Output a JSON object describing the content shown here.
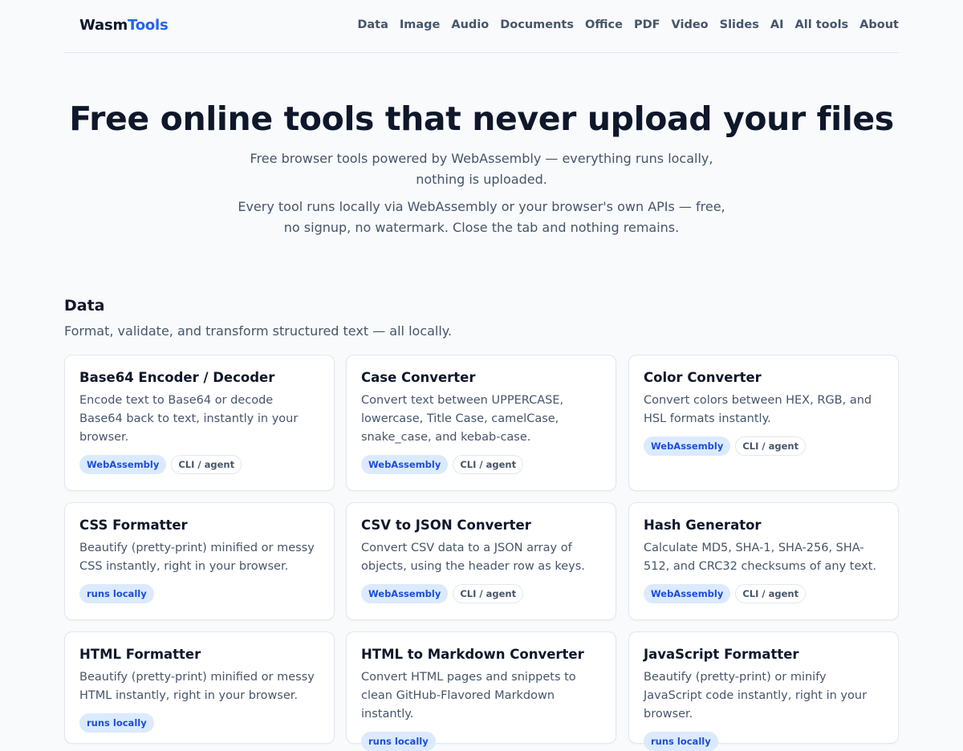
{
  "header": {
    "logo_part1": "Wasm",
    "logo_part2": "Tools",
    "nav": [
      "Data",
      "Image",
      "Audio",
      "Documents",
      "Office",
      "PDF",
      "Video",
      "Slides",
      "AI",
      "All tools",
      "About"
    ]
  },
  "hero": {
    "title": "Free online tools that never upload your files",
    "subtitle1": "Free browser tools powered by WebAssembly — everything runs locally, nothing is uploaded.",
    "subtitle2": "Every tool runs locally via WebAssembly or your browser's own APIs — free, no signup, no watermark. Close the tab and nothing remains."
  },
  "section": {
    "title": "Data",
    "description": "Format, validate, and transform structured text — all locally."
  },
  "cards": [
    {
      "title": "Base64 Encoder / Decoder",
      "desc": "Encode text to Base64 or decode Base64 back to text, instantly in your browser.",
      "badges": [
        "WebAssembly",
        "CLI / agent"
      ]
    },
    {
      "title": "Case Converter",
      "desc": "Convert text between UPPERCASE, lowercase, Title Case, camelCase, snake_case, and kebab-case.",
      "badges": [
        "WebAssembly",
        "CLI / agent"
      ]
    },
    {
      "title": "Color Converter",
      "desc": "Convert colors between HEX, RGB, and HSL formats instantly.",
      "badges": [
        "WebAssembly",
        "CLI / agent"
      ]
    },
    {
      "title": "CSS Formatter",
      "desc": "Beautify (pretty-print) minified or messy CSS instantly, right in your browser.",
      "badges": [
        "runs locally"
      ]
    },
    {
      "title": "CSV to JSON Converter",
      "desc": "Convert CSV data to a JSON array of objects, using the header row as keys.",
      "badges": [
        "WebAssembly",
        "CLI / agent"
      ]
    },
    {
      "title": "Hash Generator",
      "desc": "Calculate MD5, SHA-1, SHA-256, SHA-512, and CRC32 checksums of any text.",
      "badges": [
        "WebAssembly",
        "CLI / agent"
      ]
    },
    {
      "title": "HTML Formatter",
      "desc": "Beautify (pretty-print) minified or messy HTML instantly, right in your browser.",
      "badges": []
    },
    {
      "title": "HTML to Markdown Converter",
      "desc": "Convert HTML pages and snippets to clean GitHub-Flavored Markdown instantly.",
      "badges": []
    },
    {
      "title": "JavaScript Formatter",
      "desc": "Beautify (pretty-print) or minify JavaScript code instantly, right in your browser.",
      "badges": []
    }
  ],
  "colors": {
    "accent": "#2563eb",
    "badge_wasm_bg": "#dbeafe",
    "text_primary": "#0f172a",
    "text_muted": "#475569"
  }
}
